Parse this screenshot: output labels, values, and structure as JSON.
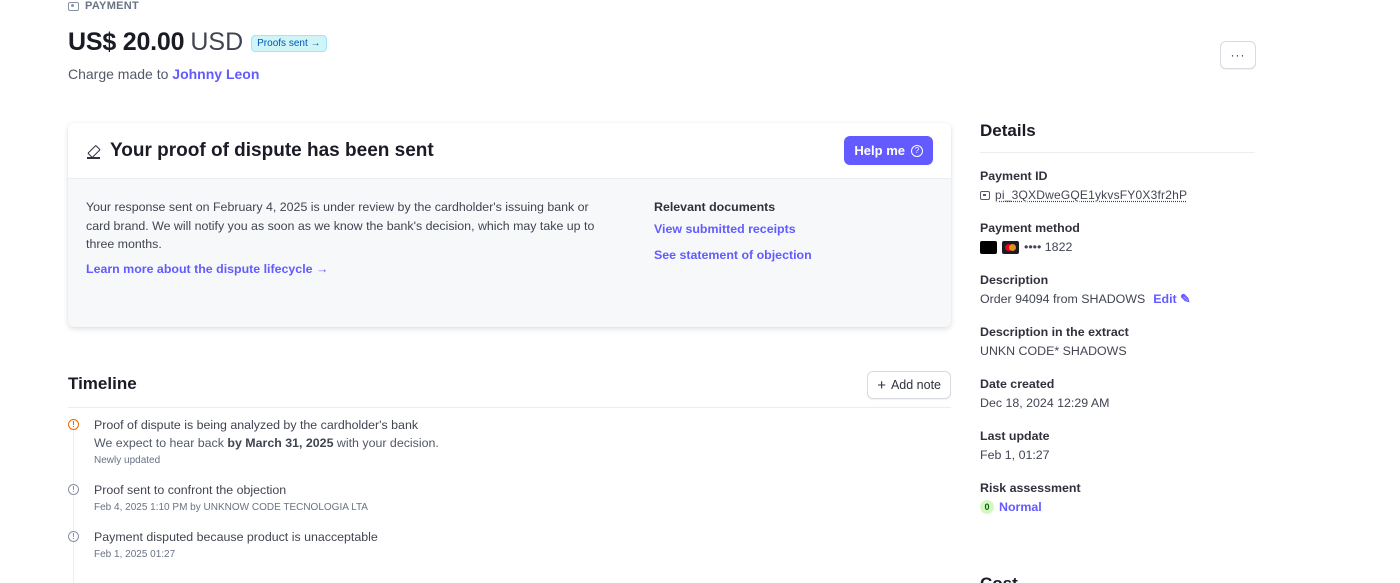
{
  "header": {
    "section_label": "PAYMENT",
    "amount": "US$ 20.00",
    "currency": "USD",
    "status_badge": "Proofs sent →",
    "charge_prefix": "Charge made to",
    "customer_name": "Johnny Leon",
    "more_button": "···"
  },
  "dispute_card": {
    "title": "Your proof of dispute has been sent",
    "help_button": "Help me",
    "body_text": "Your response sent on February 4, 2025 is under review by the cardholder's issuing bank or card brand. We will notify you as soon as we know the bank's decision, which may take up to three months.",
    "learn_more_link": "Learn more about the dispute lifecycle →",
    "documents_heading": "Relevant documents",
    "documents": [
      "View submitted receipts",
      "See statement of objection"
    ]
  },
  "timeline": {
    "title": "Timeline",
    "add_note_button": "Add note",
    "items": [
      {
        "title": "Proof of dispute is being analyzed by the cardholder's bank",
        "sub_prefix": "We expect to hear back ",
        "sub_bold": "by March 31, 2025",
        "sub_suffix": " with your decision.",
        "meta": "Newly updated",
        "icon": "warning-icon",
        "color": "#ed6704"
      },
      {
        "title": "Proof sent to confront the objection",
        "meta": "Feb 4, 2025 1:10 PM by UNKNOW CODE TECNOLOGIA LTA",
        "icon": "info-icon"
      },
      {
        "title": "Payment disputed because product is unacceptable",
        "meta": "Feb 1, 2025 01:27",
        "icon": "info-icon"
      }
    ]
  },
  "details": {
    "title": "Details",
    "payment_id_label": "Payment ID",
    "payment_id": "pi_3QXDweGQE1ykvsFY0X3fr2hP",
    "payment_method_label": "Payment method",
    "card_last4": "•••• 1822",
    "description_label": "Description",
    "description": "Order 94094 from SHADOWS",
    "edit_label": "Edit",
    "extract_label": "Description in the extract",
    "extract": "UNKN CODE* SHADOWS",
    "date_created_label": "Date created",
    "date_created": "Dec 18, 2024 12:29 AM",
    "last_update_label": "Last update",
    "last_update": "Feb 1, 01:27",
    "risk_label": "Risk assessment",
    "risk_score": "0",
    "risk_level": "Normal",
    "next_heading": "Cost"
  },
  "colors": {
    "accent": "#635bff",
    "warning": "#ed6704",
    "badge_bg": "#cff5f6",
    "risk_bg": "#d7f7c2"
  }
}
